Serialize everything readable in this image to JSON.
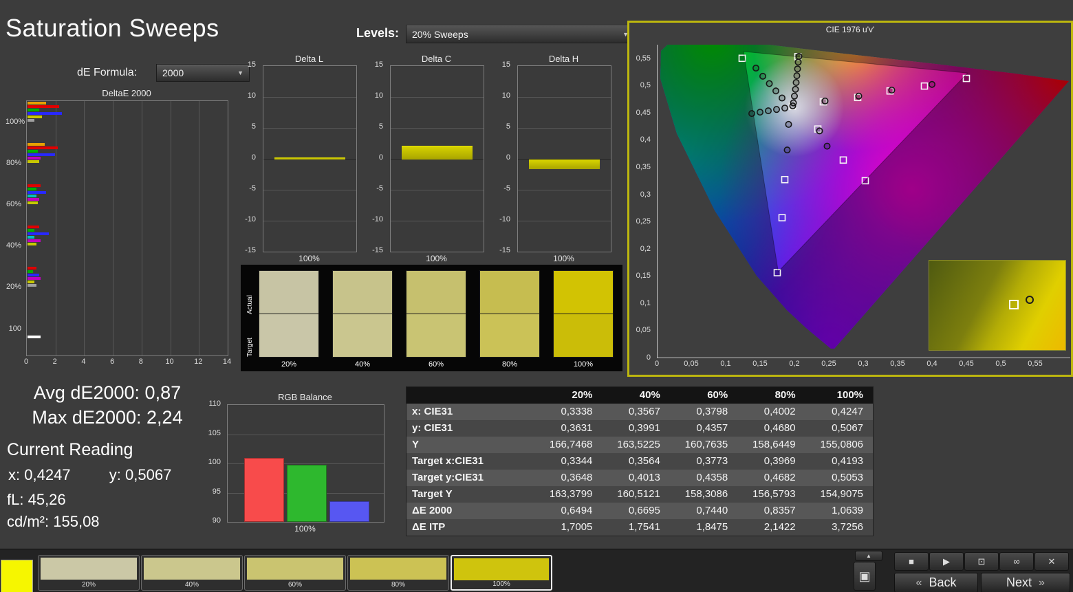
{
  "header": {
    "title": "Saturation Sweeps",
    "levels_label": "Levels:",
    "levels_value": "20% Sweeps",
    "de_formula_label": "dE Formula:",
    "de_formula_value": "2000"
  },
  "stats": {
    "avg_label": "Avg dE2000:",
    "avg_value": "0,87",
    "max_label": "Max dE2000:",
    "max_value": "2,24",
    "current_reading_title": "Current Reading",
    "x_label": "x:",
    "x_value": "0,4247",
    "y_label": "y:",
    "y_value": "0,5067",
    "fl_label": "fL:",
    "fl_value": "45,26",
    "cd_label": "cd/m²:",
    "cd_value": "155,08"
  },
  "chart_data": [
    {
      "id": "deltae_bars",
      "type": "bar",
      "title": "DeltaE 2000",
      "orientation": "horizontal",
      "xlim": [
        0,
        14
      ],
      "xticks": [
        0,
        2,
        4,
        6,
        8,
        10,
        12,
        14
      ],
      "groups": [
        {
          "label": "100%",
          "bars": [
            {
              "color": "#e8a000",
              "value": 1.3
            },
            {
              "color": "#e00000",
              "value": 2.2
            },
            {
              "color": "#00b000",
              "value": 0.8
            },
            {
              "color": "#2828ff",
              "value": 2.4
            },
            {
              "color": "#c8c800",
              "value": 1.0
            },
            {
              "color": "#a0a0a0",
              "value": 0.5
            }
          ]
        },
        {
          "label": "80%",
          "bars": [
            {
              "color": "#e8a000",
              "value": 1.2
            },
            {
              "color": "#e00000",
              "value": 2.1
            },
            {
              "color": "#00b000",
              "value": 0.7
            },
            {
              "color": "#2828ff",
              "value": 1.9
            },
            {
              "color": "#c000c0",
              "value": 0.9
            },
            {
              "color": "#c8c800",
              "value": 0.8
            }
          ]
        },
        {
          "label": "60%",
          "bars": [
            {
              "color": "#e00000",
              "value": 0.9
            },
            {
              "color": "#00b000",
              "value": 0.6
            },
            {
              "color": "#2828ff",
              "value": 1.3
            },
            {
              "color": "#00c0c0",
              "value": 0.6
            },
            {
              "color": "#c000c0",
              "value": 0.8
            },
            {
              "color": "#c8c800",
              "value": 0.7
            }
          ]
        },
        {
          "label": "40%",
          "bars": [
            {
              "color": "#e00000",
              "value": 0.8
            },
            {
              "color": "#00b000",
              "value": 0.5
            },
            {
              "color": "#2828ff",
              "value": 1.5
            },
            {
              "color": "#00c0c0",
              "value": 0.5
            },
            {
              "color": "#c000c0",
              "value": 0.9
            },
            {
              "color": "#c8c800",
              "value": 0.6
            }
          ]
        },
        {
          "label": "20%",
          "bars": [
            {
              "color": "#e00000",
              "value": 0.6
            },
            {
              "color": "#00b000",
              "value": 0.4
            },
            {
              "color": "#2828ff",
              "value": 0.8
            },
            {
              "color": "#c000c0",
              "value": 0.9
            },
            {
              "color": "#c8c800",
              "value": 0.5
            },
            {
              "color": "#a0a0a0",
              "value": 0.6
            }
          ]
        },
        {
          "label": "100",
          "bars": [
            {
              "color": "#ffffff",
              "value": 0.9
            }
          ]
        }
      ]
    },
    {
      "id": "delta_l",
      "type": "bar",
      "title": "Delta L",
      "categories": [
        "100%"
      ],
      "values": [
        0.2
      ],
      "ylim": [
        -15,
        15
      ],
      "yticks": [
        15,
        10,
        5,
        0,
        -5,
        -10,
        -15
      ],
      "bar_color": "#c8c400"
    },
    {
      "id": "delta_c",
      "type": "bar",
      "title": "Delta C",
      "categories": [
        "100%"
      ],
      "values": [
        2.1
      ],
      "ylim": [
        -15,
        15
      ],
      "yticks": [
        15,
        10,
        5,
        0,
        -5,
        -10,
        -15
      ],
      "bar_color": "#c8c400"
    },
    {
      "id": "delta_h",
      "type": "bar",
      "title": "Delta H",
      "categories": [
        "100%"
      ],
      "values": [
        -1.4
      ],
      "ylim": [
        -15,
        15
      ],
      "yticks": [
        15,
        10,
        5,
        0,
        -5,
        -10,
        -15
      ],
      "bar_color": "#c8c400"
    },
    {
      "id": "rgb_balance",
      "type": "bar",
      "title": "RGB Balance",
      "categories": [
        "100%"
      ],
      "ylim": [
        90,
        110
      ],
      "yticks": [
        110,
        105,
        100,
        95,
        90
      ],
      "series": [
        {
          "name": "Red",
          "color": "#f84b4b",
          "value": 100.9
        },
        {
          "name": "Green",
          "color": "#2eb82e",
          "value": 99.8
        },
        {
          "name": "Blue",
          "color": "#5757f2",
          "value": 93.5
        }
      ]
    },
    {
      "id": "cie_diagram",
      "type": "scatter",
      "title": "CIE 1976 u'v'",
      "xlim": [
        0,
        0.6
      ],
      "ylim": [
        0,
        0.575
      ],
      "xticks": [
        "0",
        "0,05",
        "0,1",
        "0,15",
        "0,2",
        "0,25",
        "0,3",
        "0,35",
        "0,4",
        "0,45",
        "0,5",
        "0,55"
      ],
      "yticks": [
        "0",
        "0,05",
        "0,1",
        "0,15",
        "0,2",
        "0,25",
        "0,3",
        "0,35",
        "0,4",
        "0,45",
        "0,5",
        "0,55"
      ],
      "gamut_triangle": [
        [
          0.125,
          0.5625
        ],
        [
          0.4507,
          0.5229
        ],
        [
          0.1754,
          0.1579
        ]
      ],
      "targets": [
        [
          0.123,
          0.55
        ],
        [
          0.204,
          0.553
        ],
        [
          0.449,
          0.513
        ],
        [
          0.388,
          0.499
        ],
        [
          0.338,
          0.49
        ],
        [
          0.291,
          0.478
        ],
        [
          0.241,
          0.47
        ],
        [
          0.196,
          0.462
        ],
        [
          0.233,
          0.42
        ],
        [
          0.27,
          0.363
        ],
        [
          0.302,
          0.325
        ],
        [
          0.185,
          0.327
        ],
        [
          0.181,
          0.257
        ],
        [
          0.174,
          0.156
        ]
      ],
      "measurements": [
        [
          0.1975,
          0.468
        ],
        [
          0.199,
          0.4805
        ],
        [
          0.2005,
          0.493
        ],
        [
          0.2015,
          0.5055
        ],
        [
          0.2025,
          0.518
        ],
        [
          0.2035,
          0.5305
        ],
        [
          0.2045,
          0.543
        ],
        [
          0.2055,
          0.5535
        ],
        [
          0.143,
          0.532
        ],
        [
          0.153,
          0.517
        ],
        [
          0.1625,
          0.5035
        ],
        [
          0.172,
          0.49
        ],
        [
          0.181,
          0.477
        ],
        [
          0.137,
          0.4485
        ],
        [
          0.149,
          0.451
        ],
        [
          0.161,
          0.4535
        ],
        [
          0.173,
          0.456
        ],
        [
          0.185,
          0.4585
        ],
        [
          0.399,
          0.502
        ],
        [
          0.3405,
          0.4915
        ],
        [
          0.2925,
          0.4805
        ],
        [
          0.2435,
          0.4715
        ],
        [
          0.2355,
          0.4165
        ],
        [
          0.2465,
          0.3885
        ],
        [
          0.1905,
          0.4285
        ],
        [
          0.1885,
          0.3815
        ],
        [
          0.1965,
          0.4625
        ]
      ],
      "inset": {
        "square_pos": [
          0.585,
          0.44
        ],
        "circle_pos": [
          0.705,
          0.395
        ]
      }
    }
  ],
  "measurement_table": {
    "columns": [
      "20%",
      "40%",
      "60%",
      "80%",
      "100%"
    ],
    "rows": [
      {
        "label": "x: CIE31",
        "values": [
          "0,3338",
          "0,3567",
          "0,3798",
          "0,4002",
          "0,4247"
        ]
      },
      {
        "label": "y: CIE31",
        "values": [
          "0,3631",
          "0,3991",
          "0,4357",
          "0,4680",
          "0,5067"
        ]
      },
      {
        "label": "Y",
        "values": [
          "166,7468",
          "163,5225",
          "160,7635",
          "158,6449",
          "155,0806"
        ]
      },
      {
        "label": "Target x:CIE31",
        "values": [
          "0,3344",
          "0,3564",
          "0,3773",
          "0,3969",
          "0,4193"
        ]
      },
      {
        "label": "Target y:CIE31",
        "values": [
          "0,3648",
          "0,4013",
          "0,4358",
          "0,4682",
          "0,5053"
        ]
      },
      {
        "label": "Target Y",
        "values": [
          "163,3799",
          "160,5121",
          "158,3086",
          "156,5793",
          "154,9075"
        ]
      },
      {
        "label": "ΔE 2000",
        "values": [
          "0,6494",
          "0,6695",
          "0,7440",
          "0,8357",
          "1,0639"
        ]
      },
      {
        "label": "ΔE ITP",
        "values": [
          "1,7005",
          "1,7541",
          "1,8475",
          "2,1422",
          "3,7256"
        ]
      }
    ]
  },
  "swatch_strip": {
    "row_labels": [
      "Actual",
      "Target"
    ],
    "swatches": [
      {
        "label": "20%",
        "actual": "#c7c4a4",
        "target": "#c9c6a8"
      },
      {
        "label": "40%",
        "actual": "#c7c38b",
        "target": "#cac68f"
      },
      {
        "label": "60%",
        "actual": "#c6c06e",
        "target": "#c9c473"
      },
      {
        "label": "80%",
        "actual": "#c6bd50",
        "target": "#cbc257"
      },
      {
        "label": "100%",
        "actual": "#d2c303",
        "target": "#cbbd08"
      }
    ]
  },
  "bottom_bar": {
    "current_swatch_color": "#f6f600",
    "tiles": [
      {
        "label": "20%",
        "color": "#cbc8a6",
        "selected": false
      },
      {
        "label": "40%",
        "color": "#cbc78d",
        "selected": false
      },
      {
        "label": "60%",
        "color": "#cac470",
        "selected": false
      },
      {
        "label": "80%",
        "color": "#ccc254",
        "selected": false
      },
      {
        "label": "100%",
        "color": "#cfc40d",
        "selected": true
      }
    ],
    "back_label": "Back",
    "next_label": "Next",
    "back_icon": "«",
    "next_icon": "»",
    "up_icon": "▲",
    "view_icon": "▣",
    "small_buttons": [
      {
        "name": "stop",
        "icon": "■"
      },
      {
        "name": "play",
        "icon": "▶"
      },
      {
        "name": "measure",
        "icon": "⊡"
      },
      {
        "name": "continuous",
        "icon": "∞"
      },
      {
        "name": "close",
        "icon": "✕"
      }
    ]
  }
}
